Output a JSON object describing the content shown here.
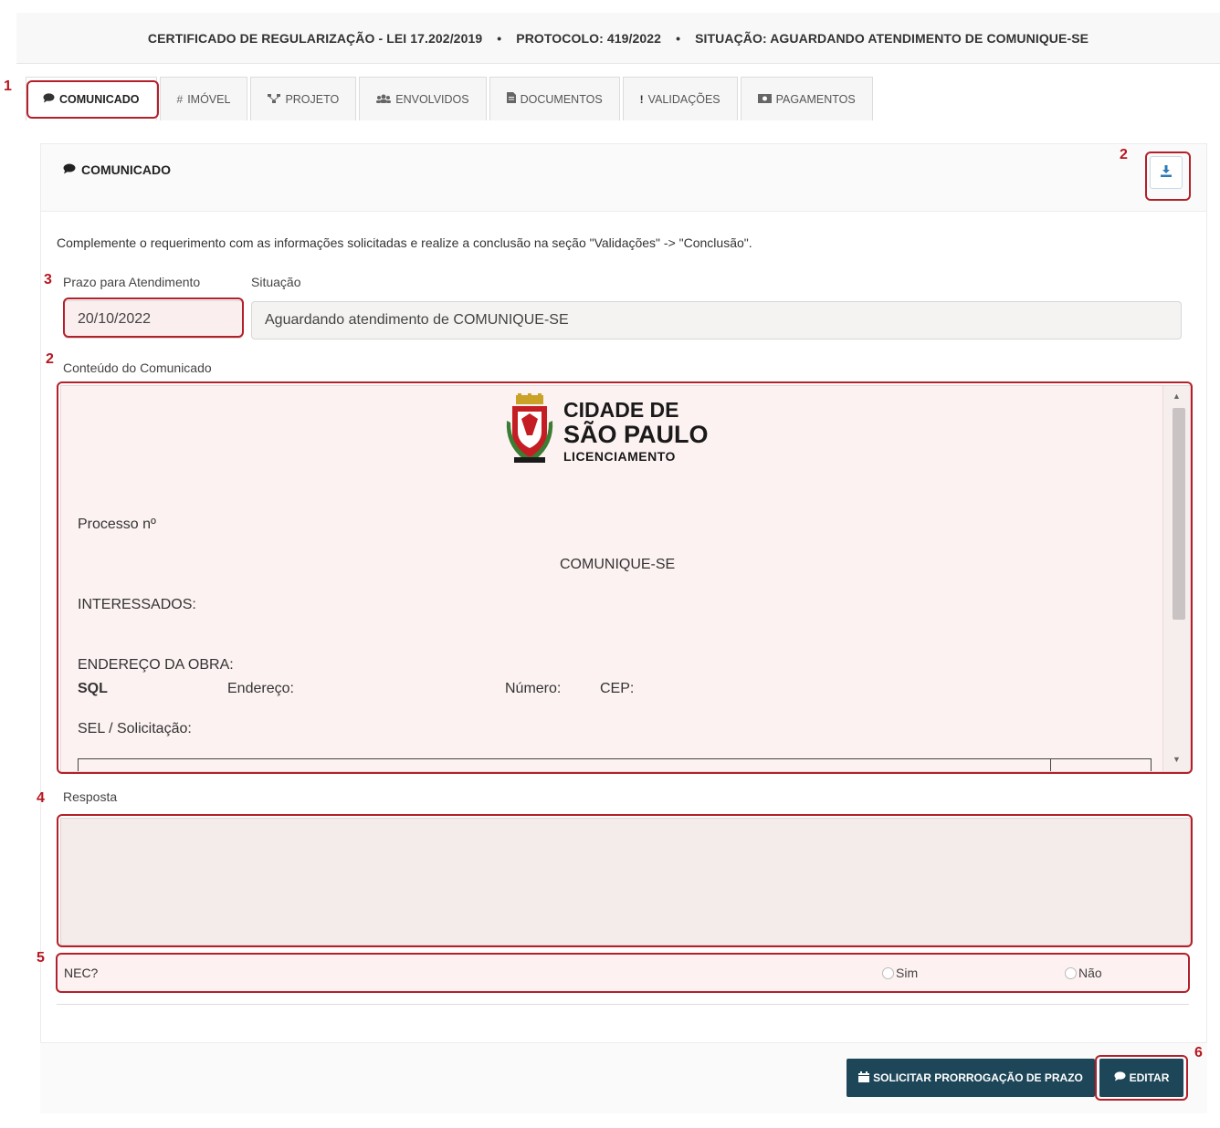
{
  "header": {
    "certificate": "CERTIFICADO DE REGULARIZAÇÃO - LEI 17.202/2019",
    "protocol": "PROTOCOLO: 419/2022",
    "status": "SITUAÇÃO: AGUARDANDO ATENDIMENTO DE COMUNIQUE-SE",
    "separator": "•"
  },
  "tabs": [
    {
      "label": "COMUNICADO",
      "icon": "speech-bubble-icon"
    },
    {
      "label": "IMÓVEL",
      "icon": "hash-icon"
    },
    {
      "label": "PROJETO",
      "icon": "sitemap-icon"
    },
    {
      "label": "ENVOLVIDOS",
      "icon": "users-icon"
    },
    {
      "label": "DOCUMENTOS",
      "icon": "file-icon"
    },
    {
      "label": "VALIDAÇÕES",
      "icon": "exclamation-icon"
    },
    {
      "label": "PAGAMENTOS",
      "icon": "money-icon"
    }
  ],
  "panel": {
    "title": "COMUNICADO",
    "instruction": "Complemente o requerimento com as informações solicitadas e realize a conclusão na seção \"Validações\" -> \"Conclusão\".",
    "deadline_label": "Prazo para Atendimento",
    "deadline_value": "20/10/2022",
    "situation_label": "Situação",
    "situation_value": "Aguardando atendimento de COMUNIQUE-SE",
    "content_label": "Conteúdo do Comunicado",
    "response_label": "Resposta",
    "nec_label": "NEC?",
    "nec_yes": "Sim",
    "nec_no": "Não"
  },
  "document": {
    "logo_line1": "CIDADE DE",
    "logo_line2": "SÃO PAULO",
    "logo_line3": "LICENCIAMENTO",
    "process": "Processo nº",
    "heading": "COMUNIQUE-SE",
    "interested": "INTERESSADOS:",
    "address_title": "ENDEREÇO DA OBRA:",
    "sql": "SQL",
    "address": "Endereço:",
    "number": "Número:",
    "cep": "CEP:",
    "sel": "SEL / Solicitação:"
  },
  "buttons": {
    "extend": "SOLICITAR PRORROGAÇÃO DE PRAZO",
    "edit": "EDITAR"
  },
  "callouts": [
    "1",
    "2",
    "3",
    "2",
    "4",
    "5",
    "6"
  ],
  "colors": {
    "highlight": "#b3202a",
    "button_bg": "#1d4658",
    "doc_bg": "#fdf2f2"
  }
}
